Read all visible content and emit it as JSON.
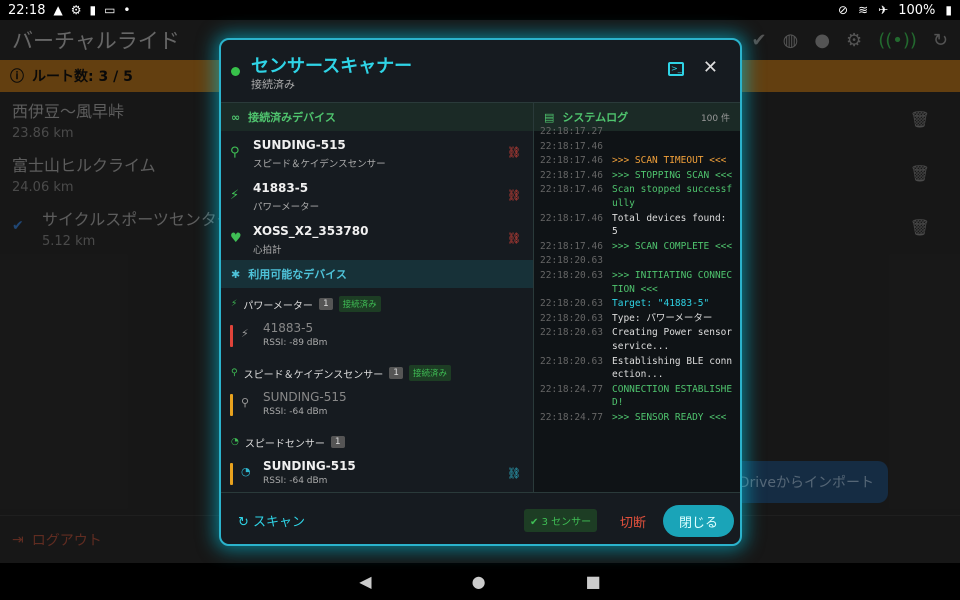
{
  "status_bar": {
    "time": "22:18",
    "battery": "100%"
  },
  "app": {
    "title": "バーチャルライド",
    "route_banner": "ルート数: 3 / 5",
    "routes": [
      {
        "name": "西伊豆〜風早峠",
        "distance": "23.86 km"
      },
      {
        "name": "富士山ヒルクライム",
        "distance": "24.06 km"
      },
      {
        "name": "サイクルスポーツセンター",
        "distance": "5.12 km"
      }
    ],
    "import_label": "e Driveからインポート",
    "logout_label": "ログアウト"
  },
  "modal": {
    "title": "センサースキャナー",
    "subtitle": "接続済み",
    "connected_header": "接続済みデバイス",
    "connected": [
      {
        "name": "SUNDING-515",
        "type": "スピード＆ケイデンスセンサー",
        "icon": "bike-icon"
      },
      {
        "name": "41883-5",
        "type": "パワーメーター",
        "icon": "bolt-icon"
      },
      {
        "name": "XOSS_X2_353780",
        "type": "心拍計",
        "icon": "heart-icon"
      }
    ],
    "available_header": "利用可能なデバイス",
    "categories": [
      {
        "label": "パワーメーター",
        "count": "1",
        "badge": "接続済み",
        "device": {
          "name": "41883-5",
          "rssi": "RSSI: -89 dBm",
          "signal_color": "#e0443a"
        }
      },
      {
        "label": "スピード＆ケイデンスセンサー",
        "count": "1",
        "badge": "接続済み",
        "device": {
          "name": "SUNDING-515",
          "rssi": "RSSI: -64 dBm",
          "signal_color": "#e8a21e"
        }
      },
      {
        "label": "スピードセンサー",
        "count": "1",
        "badge": "",
        "device": {
          "name": "SUNDING-515",
          "rssi": "RSSI: -64 dBm",
          "signal_color": "#e8a21e"
        }
      }
    ],
    "log_header": "システムログ",
    "log_count": "100 件",
    "log": [
      {
        "ts": "22:18:17.27",
        "msg": "",
        "color": "#cccccc"
      },
      {
        "ts": "22:18:17.46",
        "msg": "",
        "color": "#cccccc"
      },
      {
        "ts": "22:18:17.46",
        "msg": ">>> SCAN TIMEOUT <<<",
        "color": "#f0a03a"
      },
      {
        "ts": "22:18:17.46",
        "msg": ">>> STOPPING SCAN <<<",
        "color": "#4fc46e"
      },
      {
        "ts": "22:18:17.46",
        "msg": "Scan stopped successfully",
        "color": "#4fc46e"
      },
      {
        "ts": "22:18:17.46",
        "msg": "Total devices found: 5",
        "color": "#dddddd"
      },
      {
        "ts": "22:18:17.46",
        "msg": ">>> SCAN COMPLETE <<<",
        "color": "#4fc46e"
      },
      {
        "ts": "22:18:20.63",
        "msg": "",
        "color": "#cccccc"
      },
      {
        "ts": "22:18:20.63",
        "msg": ">>> INITIATING CONNECTION <<<",
        "color": "#4fc46e"
      },
      {
        "ts": "22:18:20.63",
        "msg": "Target: \"41883-5\"",
        "color": "#2fd4e6"
      },
      {
        "ts": "22:18:20.63",
        "msg": "Type: パワーメーター",
        "color": "#dddddd"
      },
      {
        "ts": "22:18:20.63",
        "msg": "Creating Power sensor service...",
        "color": "#dddddd"
      },
      {
        "ts": "22:18:20.63",
        "msg": "Establishing BLE connection...",
        "color": "#dddddd"
      },
      {
        "ts": "22:18:24.77",
        "msg": "CONNECTION ESTABLISHED!",
        "color": "#4fc46e"
      },
      {
        "ts": "22:18:24.77",
        "msg": ">>> SENSOR READY <<<",
        "color": "#4fc46e"
      }
    ],
    "scan_label": "スキャン",
    "sensor_count": "3 センサー",
    "disconnect_label": "切断",
    "close_label": "閉じる"
  }
}
